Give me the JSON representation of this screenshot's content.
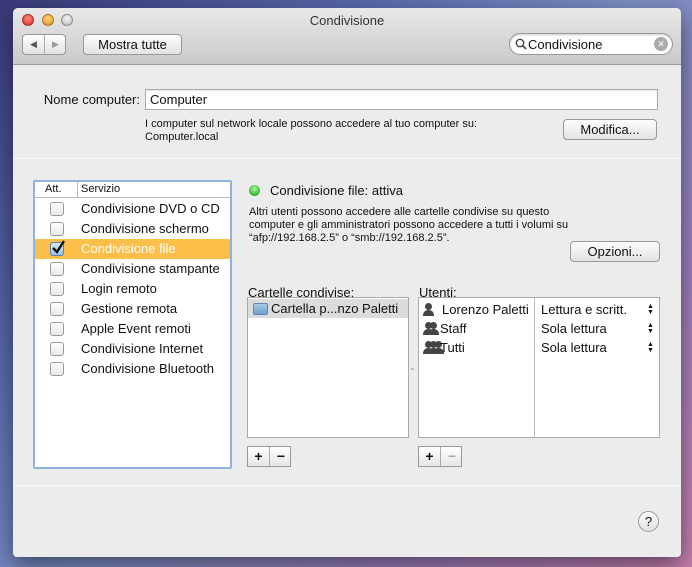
{
  "window": {
    "title": "Condivisione"
  },
  "toolbar": {
    "back": "◀",
    "forward": "▶",
    "show_all": "Mostra tutte",
    "search_value": "Condivisione",
    "search_icon": "magnifier-icon",
    "clear_icon": "✕"
  },
  "computer": {
    "label": "Nome computer:",
    "value": "Computer",
    "description": "I computer sul network locale possono accedere al tuo computer su:",
    "address": "Computer.local",
    "edit_button": "Modifica..."
  },
  "services": {
    "header_on": "Att.",
    "header_service": "Servizio",
    "items": [
      {
        "label": "Condivisione DVD o CD",
        "checked": false
      },
      {
        "label": "Condivisione schermo",
        "checked": false
      },
      {
        "label": "Condivisione file",
        "checked": true,
        "selected": true
      },
      {
        "label": "Condivisione stampante",
        "checked": false
      },
      {
        "label": "Login remoto",
        "checked": false
      },
      {
        "label": "Gestione remota",
        "checked": false
      },
      {
        "label": "Apple Event remoti",
        "checked": false
      },
      {
        "label": "Condivisione Internet",
        "checked": false
      },
      {
        "label": "Condivisione Bluetooth",
        "checked": false
      }
    ]
  },
  "status": {
    "text": "Condivisione file: attiva",
    "color": "#3cc43c",
    "description_lines": [
      "Altri utenti possono accedere alle cartelle condivise su questo",
      "computer e gli amministratori possono accedere a tutti i volumi su",
      "“afp://192.168.2.5” o “smb://192.168.2.5”."
    ],
    "options_button": "Opzioni..."
  },
  "folders": {
    "label": "Cartelle condivise:",
    "items": [
      "Cartella p...nzo Paletti"
    ],
    "add": "+",
    "remove": "−"
  },
  "users": {
    "label": "Utenti:",
    "items": [
      {
        "name": "Lorenzo Paletti",
        "permission": "Lettura e scritt."
      },
      {
        "name": "Staff",
        "permission": "Sola lettura"
      },
      {
        "name": "Tutti",
        "permission": "Sola lettura"
      }
    ],
    "add": "+",
    "remove": "−"
  },
  "help": "?",
  "accent": "#fbbf4a"
}
